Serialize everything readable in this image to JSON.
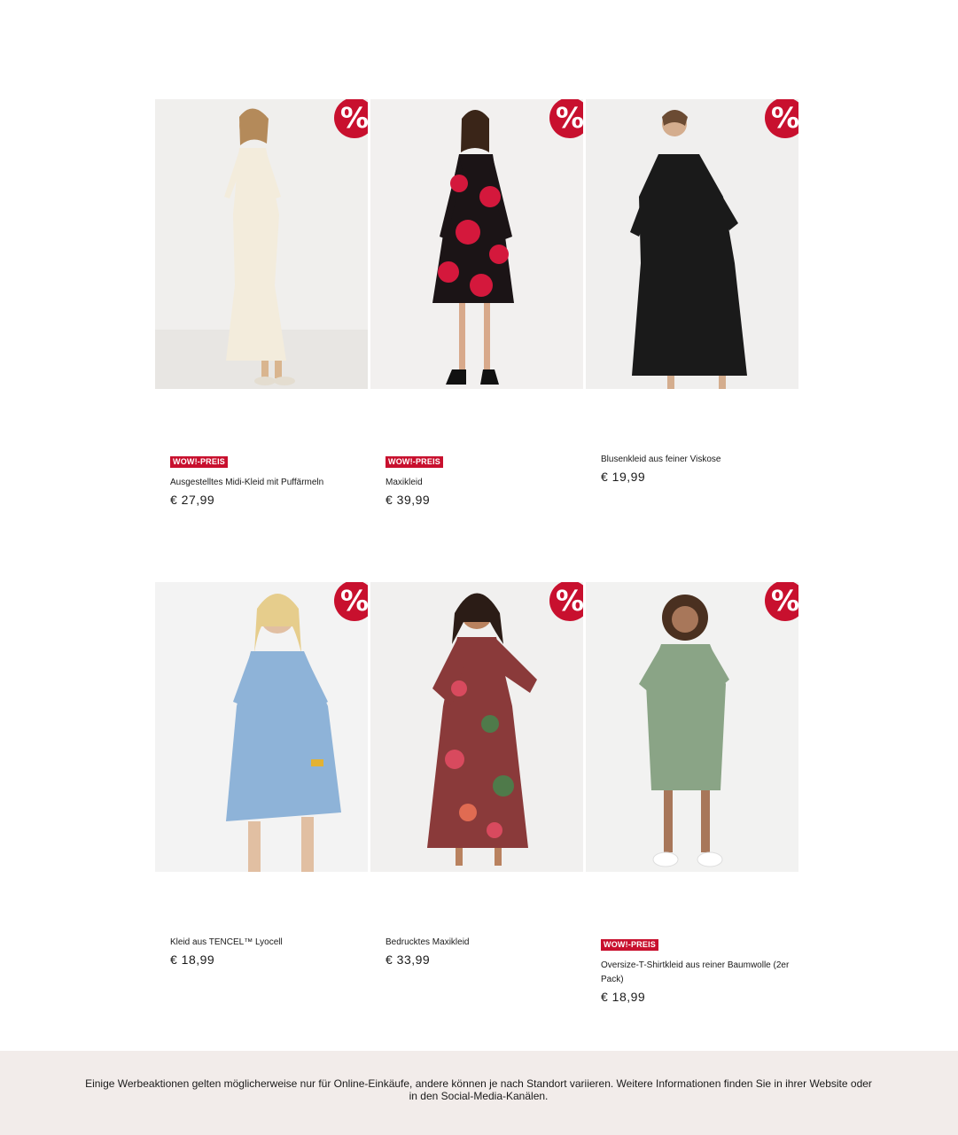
{
  "products": [
    {
      "name": "Ausgestelltes Midi-Kleid mit Puffärmeln",
      "price": "€ 27,99",
      "tag": "WOW!-PREIS",
      "badge": "%"
    },
    {
      "name": "Maxikleid",
      "price": "€ 39,99",
      "tag": "WOW!-PREIS",
      "badge": "%"
    },
    {
      "name": "Blusenkleid aus feiner Viskose",
      "price": "€ 19,99",
      "tag": "",
      "badge": "%"
    },
    {
      "name": "Kleid aus TENCEL™ Lyocell",
      "price": "€ 18,99",
      "tag": "",
      "badge": "%"
    },
    {
      "name": "Bedrucktes Maxikleid",
      "price": "€ 33,99",
      "tag": "",
      "badge": "%"
    },
    {
      "name": "Oversize-T-Shirtkleid aus reiner Baumwolle (2er Pack)",
      "price": "€ 18,99",
      "tag": "WOW!-PREIS",
      "badge": "%"
    }
  ],
  "footer": {
    "text": "Einige Werbeaktionen gelten möglicherweise nur für Online-Einkäufe, andere können je nach Standort variieren. Weitere Informationen finden Sie in ihrer Website oder in den Social-Media-Kanälen."
  },
  "colors": {
    "accent": "#c8102e",
    "footer_bg": "#f2ecea"
  }
}
